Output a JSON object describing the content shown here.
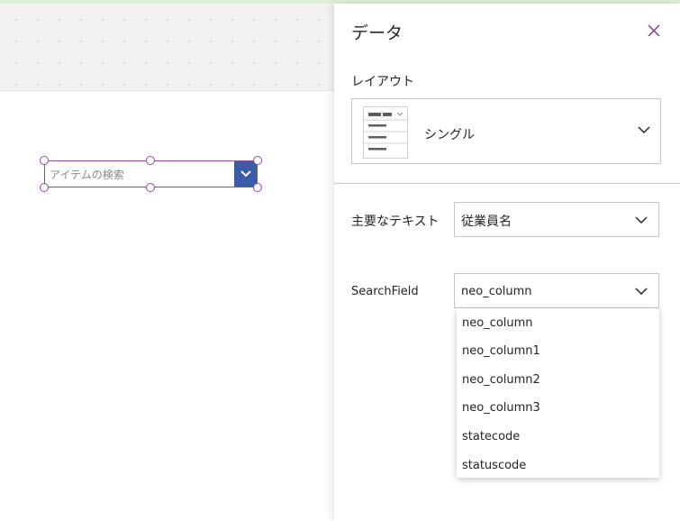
{
  "canvas": {
    "combobox_placeholder": "アイテムの検索"
  },
  "panel": {
    "title": "データ",
    "layout": {
      "label": "レイアウト",
      "value": "シングル"
    },
    "primary_text": {
      "label": "主要なテキスト",
      "value": "従業員名"
    },
    "search_field": {
      "label": "SearchField",
      "value": "neo_column",
      "options": [
        "neo_column",
        "neo_column1",
        "neo_column2",
        "neo_column3",
        "statecode",
        "statuscode"
      ]
    }
  },
  "icons": {
    "close": "close-icon",
    "chevron": "chevron-down-icon"
  },
  "colors": {
    "accent": "#3b5ba7",
    "selection": "#8a4b9e",
    "top_bar": "#dcefd9"
  }
}
